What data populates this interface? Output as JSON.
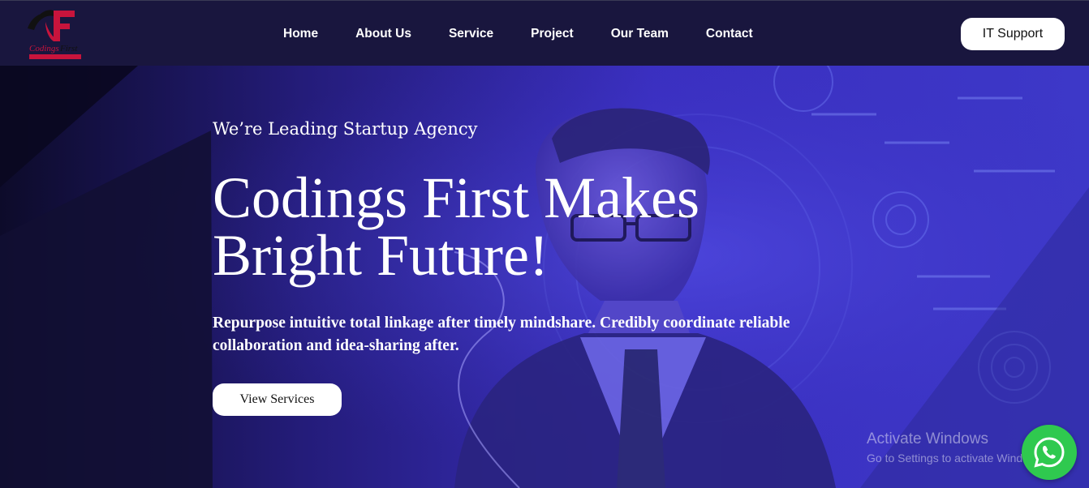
{
  "brand": {
    "logo_letter": "F",
    "logo_name": "Codings First",
    "logo_tagline": "Codings First Makes Bright Future",
    "colors": {
      "logo_red": "#c8143c",
      "logo_black": "#111111"
    }
  },
  "nav": {
    "items": [
      {
        "label": "Home"
      },
      {
        "label": "About Us"
      },
      {
        "label": "Service"
      },
      {
        "label": "Project"
      },
      {
        "label": "Our Team"
      },
      {
        "label": "Contact"
      }
    ],
    "cta_label": "IT Support"
  },
  "hero": {
    "eyebrow": "We’re Leading Startup Agency",
    "headline": "Codings First Makes Bright Future!",
    "description": "Repurpose intuitive total linkage after timely mindshare. Credibly coordinate reliable collaboration and idea-sharing after.",
    "cta_label": "View Services",
    "background_icon": "person-tech-background"
  },
  "watermark": {
    "title": "Activate Windows",
    "subtitle": "Go to Settings to activate Windows."
  },
  "whatsapp": {
    "icon": "whatsapp-icon",
    "color": "#2fc94f"
  },
  "theme": {
    "navbar_bg": "#19163e",
    "hero_overlay": "#3b2fc4",
    "text": "#ffffff"
  }
}
